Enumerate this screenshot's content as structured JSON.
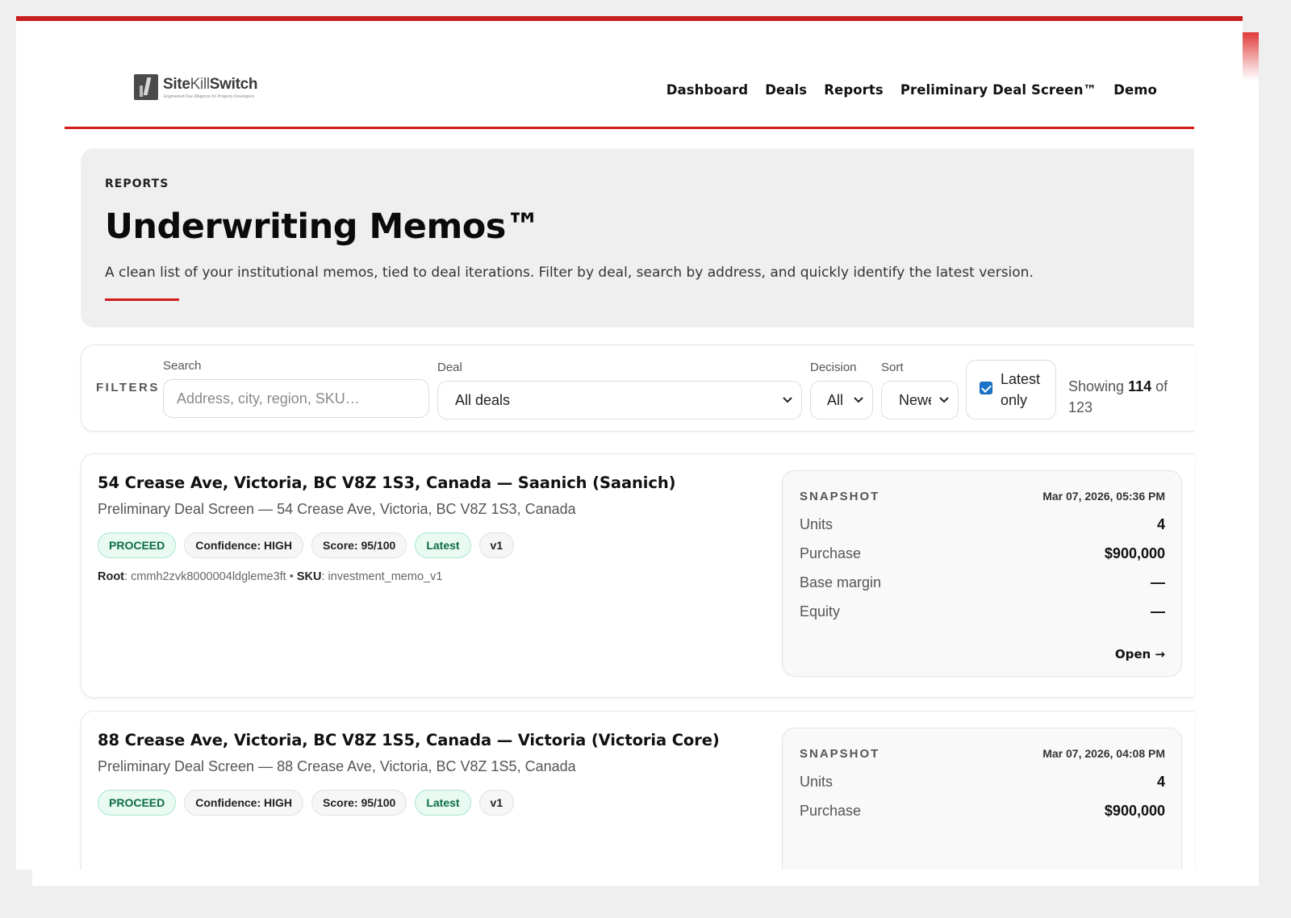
{
  "brand": {
    "logo_main": "Site",
    "logo_light": "Kill",
    "logo_end": "Switch",
    "logo_tagline": "Engineered Due Diligence for Property Developers",
    "accent_color": "#d11a1a"
  },
  "nav": {
    "items": [
      "Dashboard",
      "Deals",
      "Reports",
      "Preliminary Deal Screen™",
      "Demo"
    ]
  },
  "hero": {
    "eyebrow": "REPORTS",
    "title": "Underwriting Memos™",
    "description": "A clean list of your institutional memos, tied to deal iterations. Filter by deal, search by address, and quickly identify the latest version."
  },
  "filters": {
    "label": "FILTERS",
    "search_label": "Search",
    "search_placeholder": "Address, city, region, SKU…",
    "deal_label": "Deal",
    "deal_value": "All deals",
    "decision_label": "Decision",
    "decision_value": "All",
    "sort_label": "Sort",
    "sort_value": "Newest",
    "latest_only_label": "Latest only",
    "latest_only_checked": true,
    "showing_prefix": "Showing",
    "showing_count": "114",
    "showing_suffix": "of 123"
  },
  "memos": [
    {
      "title": "54 Crease Ave, Victoria, BC V8Z 1S3, Canada — Saanich (Saanich)",
      "subtitle": "Preliminary Deal Screen — 54 Crease Ave, Victoria, BC V8Z 1S3, Canada",
      "badges": [
        "PROCEED",
        "Confidence: HIGH",
        "Score: 95/100",
        "Latest",
        "v1"
      ],
      "root_label": "Root",
      "root_value": "cmmh2zvk8000004ldgleme3ft",
      "sku_label": "SKU",
      "sku_value": "investment_memo_v1",
      "snapshot": {
        "label": "SNAPSHOT",
        "date": "Mar 07, 2026, 05:36 PM",
        "rows": [
          {
            "k": "Units",
            "v": "4"
          },
          {
            "k": "Purchase",
            "v": "$900,000"
          },
          {
            "k": "Base margin",
            "v": "—"
          },
          {
            "k": "Equity",
            "v": "—"
          }
        ],
        "open_label": "Open →"
      }
    },
    {
      "title": "88 Crease Ave, Victoria, BC V8Z 1S5, Canada — Victoria (Victoria Core)",
      "subtitle": "Preliminary Deal Screen — 88 Crease Ave, Victoria, BC V8Z 1S5, Canada",
      "badges": [
        "PROCEED",
        "Confidence: HIGH",
        "Score: 95/100",
        "Latest",
        "v1"
      ],
      "snapshot": {
        "label": "SNAPSHOT",
        "date": "Mar 07, 2026, 04:08 PM",
        "rows": [
          {
            "k": "Units",
            "v": "4"
          },
          {
            "k": "Purchase",
            "v": "$900,000"
          }
        ]
      }
    }
  ]
}
